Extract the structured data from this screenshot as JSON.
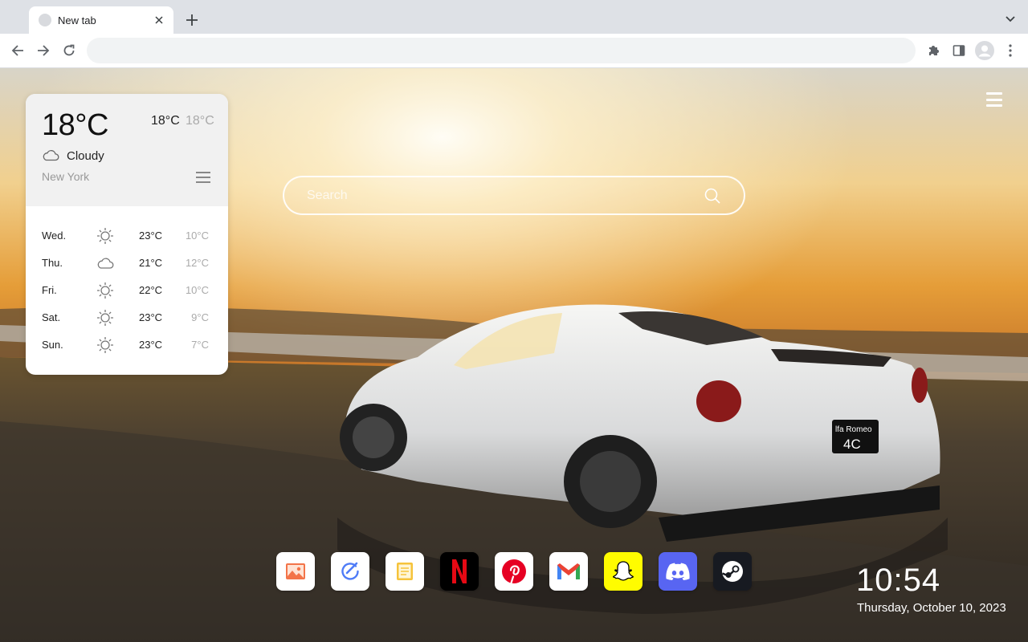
{
  "browser": {
    "tab_title": "New tab",
    "url": ""
  },
  "search": {
    "placeholder": "Search"
  },
  "weather": {
    "current_temp": "18°C",
    "today_high": "18°C",
    "today_low": "18°C",
    "condition": "Cloudy",
    "condition_icon": "cloud-icon",
    "city": "New York",
    "forecast": [
      {
        "day": "Wed.",
        "icon": "sun-icon",
        "high": "23°C",
        "low": "10°C"
      },
      {
        "day": "Thu.",
        "icon": "cloud-icon",
        "high": "21°C",
        "low": "12°C"
      },
      {
        "day": "Fri.",
        "icon": "sun-icon",
        "high": "22°C",
        "low": "10°C"
      },
      {
        "day": "Sat.",
        "icon": "sun-icon",
        "high": "23°C",
        "low": "9°C"
      },
      {
        "day": "Sun.",
        "icon": "sun-icon",
        "high": "23°C",
        "low": "7°C"
      }
    ]
  },
  "dock": {
    "apps": [
      {
        "name": "photos",
        "icon": "photos-icon",
        "color": "#ffffff"
      },
      {
        "name": "edit",
        "icon": "edit-icon",
        "color": "#ffffff"
      },
      {
        "name": "notes",
        "icon": "notes-icon",
        "color": "#ffffff"
      },
      {
        "name": "netflix",
        "icon": "netflix-icon",
        "color": "#000000"
      },
      {
        "name": "pinterest",
        "icon": "pinterest-icon",
        "color": "#ffffff"
      },
      {
        "name": "gmail",
        "icon": "gmail-icon",
        "color": "#ffffff"
      },
      {
        "name": "snapchat",
        "icon": "snapchat-icon",
        "color": "#fffc00"
      },
      {
        "name": "discord",
        "icon": "discord-icon",
        "color": "#5865f2"
      },
      {
        "name": "steam",
        "icon": "steam-icon",
        "color": "#171a21"
      }
    ]
  },
  "clock": {
    "time": "10:54",
    "date": "Thursday, October 10, 2023"
  },
  "background": {
    "license_plate_line1": "lfa Romeo",
    "license_plate_line2": "4C"
  }
}
